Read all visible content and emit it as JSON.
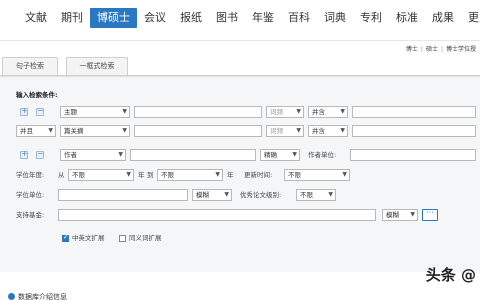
{
  "nav": {
    "items": [
      "文献",
      "期刊",
      "博硕士",
      "会议",
      "报纸",
      "图书",
      "年鉴",
      "百科",
      "词典",
      "专利",
      "标准",
      "成果",
      "更多"
    ],
    "active_index": 2
  },
  "breadcrumb": [
    "博士",
    "硕士",
    "博士学位授"
  ],
  "tabs": [
    "句子检索",
    "一框式检索"
  ],
  "section_title": "输入检索条件:",
  "rows": {
    "row1": {
      "field": "主题",
      "freq": "词频",
      "match": "并含"
    },
    "row2": {
      "logic": "并且",
      "field": "篇关摘",
      "freq": "词频",
      "match": "并含"
    },
    "row3": {
      "field": "作者",
      "match": "精确",
      "unit_label": "作者单位:"
    },
    "year": {
      "label": "学位年度:",
      "from": "从",
      "from_val": "不限",
      "year_unit1": "年",
      "to": "到",
      "to_val": "不限",
      "year_unit2": "年",
      "update_label": "更新时间:",
      "update_val": "不限"
    },
    "unit": {
      "label": "学位单位:",
      "match": "模糊",
      "excellent_label": "优秀论文级别:",
      "excellent_val": "不限"
    },
    "fund": {
      "label": "支持基金:",
      "match": "模糊",
      "more": "···"
    }
  },
  "options": {
    "cn_en": "中英文扩展",
    "synonym": "同义词扩展"
  },
  "bottom_text": "数据库介绍信息",
  "watermark": "头条 @"
}
